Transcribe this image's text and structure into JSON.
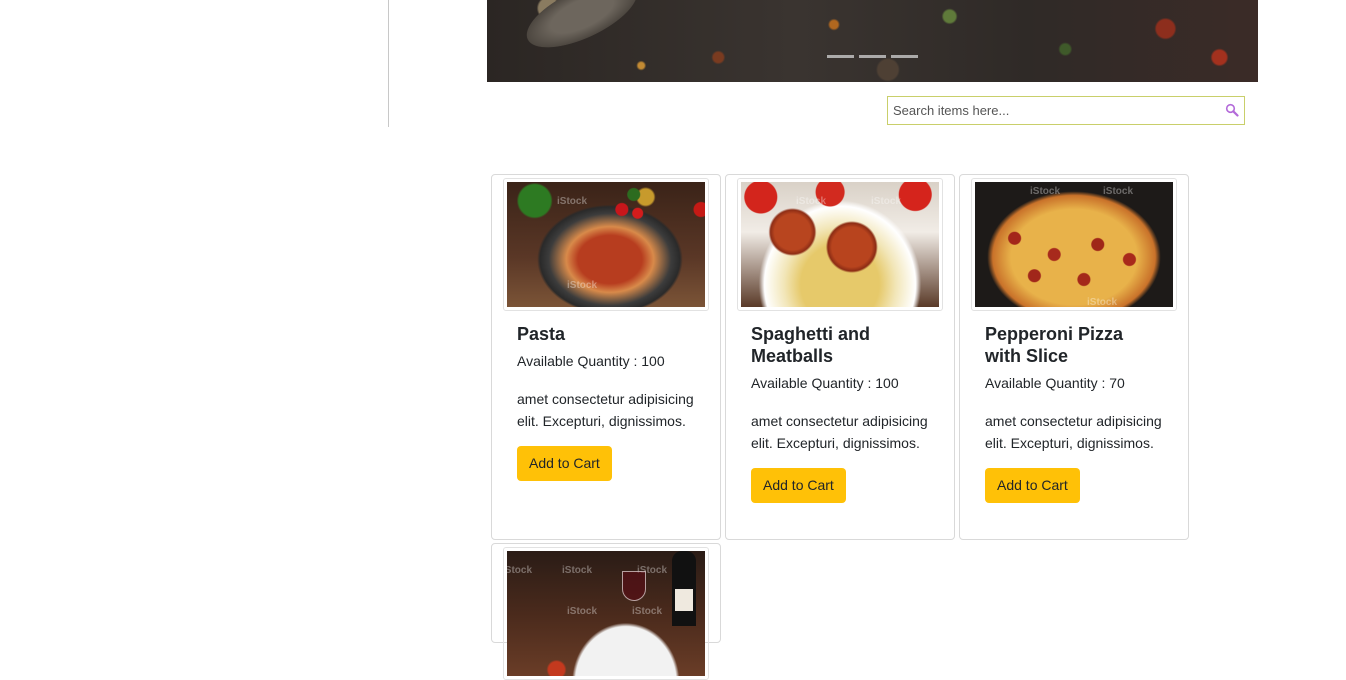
{
  "search": {
    "placeholder": "Search items here..."
  },
  "carousel": {
    "slide_count": 3
  },
  "products": [
    {
      "name": "Pasta",
      "quantity_text": "Available Quantity : 100",
      "description": "amet consectetur adipisicing elit. Excepturi, dignissimos.",
      "button_label": "Add to Cart",
      "image": "pasta-photo"
    },
    {
      "name": "Spaghetti and Meatballs",
      "quantity_text": "Available Quantity : 100",
      "description": "amet consectetur adipisicing elit. Excepturi, dignissimos.",
      "button_label": "Add to Cart",
      "image": "meatballs-photo"
    },
    {
      "name": "Pepperoni Pizza with Slice",
      "quantity_text": "Available Quantity : 70",
      "description": "amet consectetur adipisicing elit. Excepturi, dignissimos.",
      "button_label": "Add to Cart",
      "image": "pizza-photo"
    },
    {
      "image": "dinner-photo"
    }
  ],
  "colors": {
    "button": "#ffc107",
    "search_border": "#c9cf6a",
    "card_border": "#d9d9d9"
  },
  "icons": {
    "search": "magnifier-icon"
  }
}
